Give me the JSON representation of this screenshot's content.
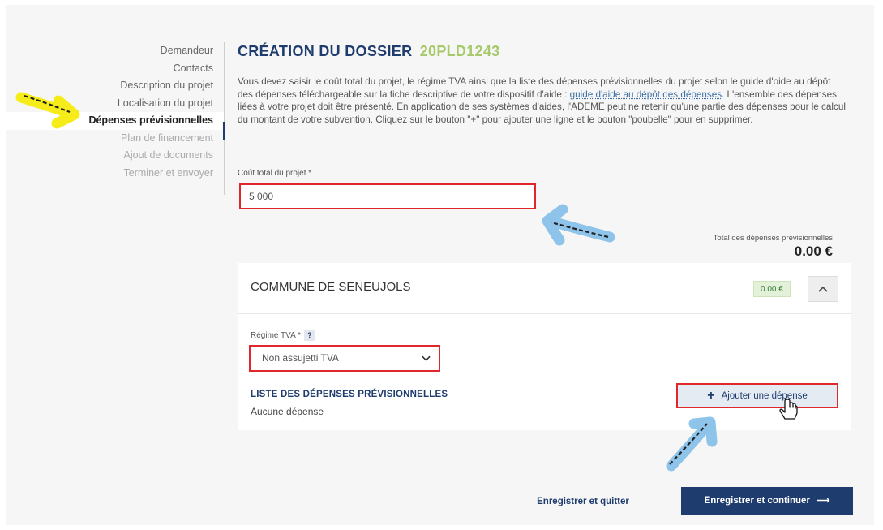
{
  "sidebar": {
    "items": [
      {
        "label": "Demandeur",
        "state": "done"
      },
      {
        "label": "Contacts",
        "state": "done"
      },
      {
        "label": "Description du projet",
        "state": "done"
      },
      {
        "label": "Localisation du projet",
        "state": "done"
      },
      {
        "label": "Dépenses prévisionnelles",
        "state": "active"
      },
      {
        "label": "Plan de financement",
        "state": "disabled"
      },
      {
        "label": "Ajout de documents",
        "state": "disabled"
      },
      {
        "label": "Terminer et envoyer",
        "state": "disabled"
      }
    ]
  },
  "header": {
    "title": "CRÉATION DU DOSSIER",
    "dossier_code": "20PLD1243"
  },
  "intro": {
    "part1": "Vous devez saisir le coût total du projet, le régime TVA ainsi que la liste des dépenses prévisionnelles du projet selon le guide d'oide au dépôt des dépenses téléchargeable sur la fiche descriptive de votre dispositif d'aide : ",
    "link": "guide d'aide au dépôt des dépenses",
    "part2": ". L'ensemble des dépenses liées à votre projet doit être présenté. En application de ses systèmes d'aides, l'ADEME peut ne retenir qu'une partie des dépenses pour le calcul du montant de votre subvention. Cliquez sur le bouton \"+\" pour ajouter une ligne et le bouton \"poubelle\" pour en supprimer."
  },
  "cost": {
    "label": "Coût total du projet *",
    "value": "5 000"
  },
  "total": {
    "label": "Total des dépenses prévisionnelles",
    "value": "0.00 €"
  },
  "card": {
    "title": "COMMUNE DE SENEUJOLS",
    "badge": "0.00 €",
    "collapse_icon": "chevron-up",
    "tva_label": "Régime TVA *",
    "tva_help": "?",
    "tva_value": "Non assujetti TVA",
    "list_title": "LISTE DES DÉPENSES PRÉVISIONNELLES",
    "list_empty": "Aucune dépense",
    "add_button": "Ajouter une dépense"
  },
  "footer": {
    "save_quit": "Enregistrer et quitter",
    "save_continue": "Enregistrer et continuer"
  },
  "colors": {
    "brand": "#1f3c6e",
    "code_green": "#a6c96a",
    "highlight_red": "#e0282c",
    "arrow_yellow": "#f5ec1a",
    "arrow_blue": "#8ec3ea"
  }
}
